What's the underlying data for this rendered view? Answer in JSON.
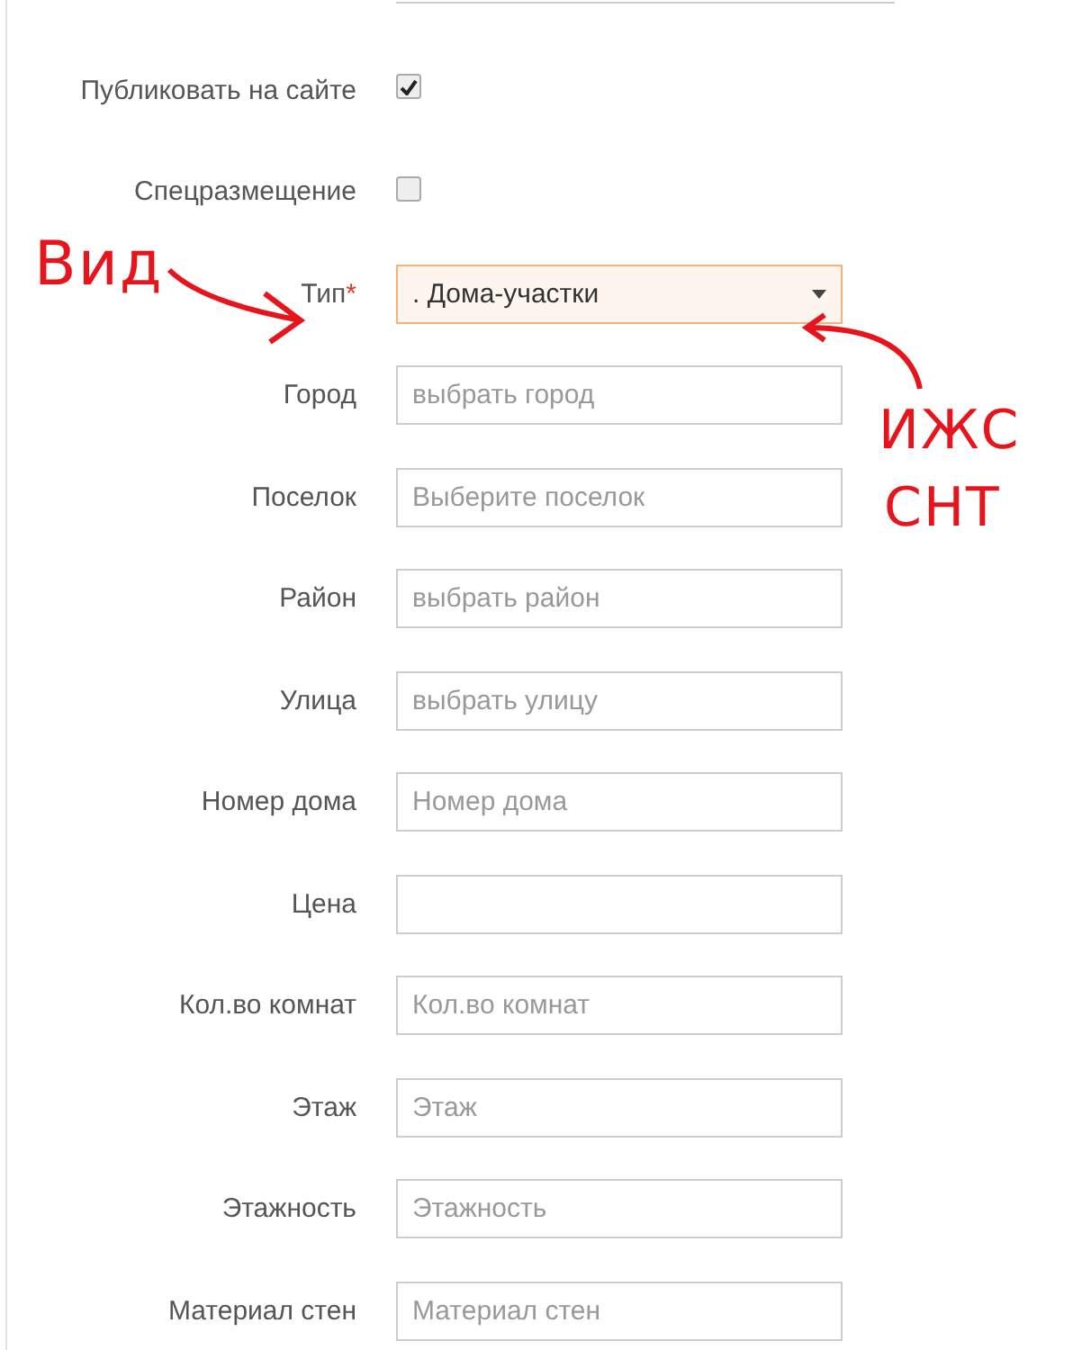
{
  "fields": [
    {
      "kind": "checkbox",
      "label": "Публиковать на сайте",
      "checked": true
    },
    {
      "kind": "checkbox",
      "label": "Спецразмещение",
      "checked": false
    },
    {
      "kind": "select",
      "label": "Тип",
      "required_mark": "*",
      "value": ". Дома-участки",
      "focused": true
    },
    {
      "kind": "text",
      "label": "Город",
      "placeholder": "выбрать город"
    },
    {
      "kind": "text",
      "label": "Поселок",
      "placeholder": "Выберите поселок"
    },
    {
      "kind": "text",
      "label": "Район",
      "placeholder": "выбрать район"
    },
    {
      "kind": "text",
      "label": "Улица",
      "placeholder": "выбрать улицу"
    },
    {
      "kind": "text",
      "label": "Номер дома",
      "placeholder": "Номер дома"
    },
    {
      "kind": "text",
      "label": "Цена"
    },
    {
      "kind": "text",
      "label": "Кол.во комнат",
      "placeholder": "Кол.во комнат"
    },
    {
      "kind": "text",
      "label": "Этаж",
      "placeholder": "Этаж"
    },
    {
      "kind": "text",
      "label": "Этажность",
      "placeholder": "Этажность"
    },
    {
      "kind": "text",
      "label": "Материал стен",
      "placeholder": "Материал стен"
    }
  ],
  "annotations": [
    {
      "text": "Вид"
    },
    {
      "text": "ИЖС"
    },
    {
      "text": "СНТ"
    }
  ]
}
